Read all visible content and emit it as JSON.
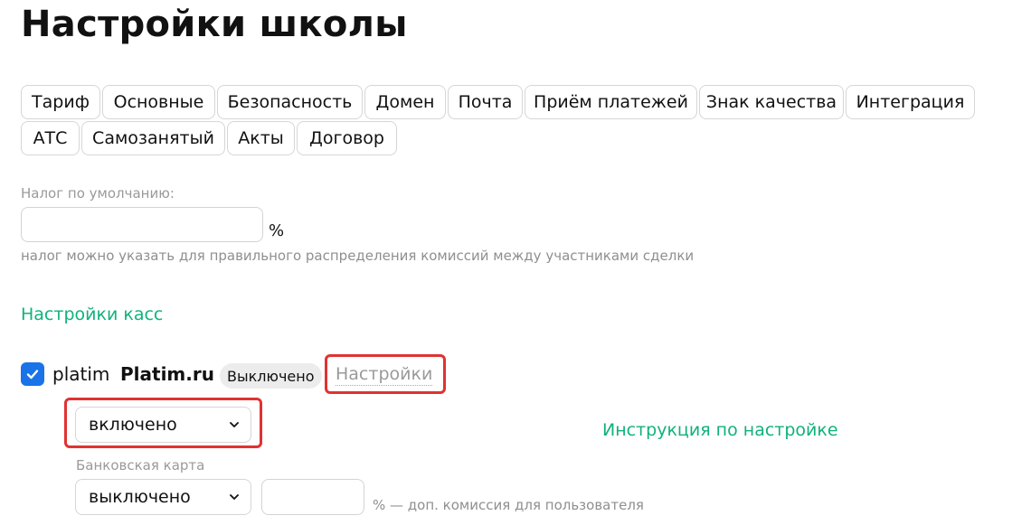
{
  "page": {
    "title": "Настройки школы"
  },
  "tabs": {
    "row1": [
      {
        "label": "Тариф"
      },
      {
        "label": "Основные"
      },
      {
        "label": "Безопасность"
      },
      {
        "label": "Домен"
      },
      {
        "label": "Почта"
      },
      {
        "label": "Приём платежей"
      },
      {
        "label": "Знак качества"
      },
      {
        "label": "Интеграция"
      }
    ],
    "row2": [
      {
        "label": "АТС"
      },
      {
        "label": "Самозанятый"
      },
      {
        "label": "Акты"
      },
      {
        "label": "Договор"
      }
    ]
  },
  "tax": {
    "label": "Налог по умолчанию:",
    "value": "",
    "unit": "%",
    "hint": "налог можно указать для правильного распределения комиссий между участниками сделки"
  },
  "cash_settings": {
    "title": "Настройки касс"
  },
  "provider": {
    "logo_text": "platim",
    "name": "Platim.ru",
    "checked": true,
    "status": "Выключено",
    "settings_link": "Настройки",
    "mode_select": "включено",
    "instruction_link": "Инструкция по настройке",
    "bank_card": {
      "label": "Банковская карта",
      "select": "выключено",
      "commission_value": "",
      "commission_hint": "% — доп. комиссия для пользователя"
    }
  },
  "colors": {
    "accent_green": "#10b27a",
    "checkbox_blue": "#1a73e8",
    "highlight_red": "#e03232"
  },
  "icons": {
    "checkbox": "check-icon",
    "select": "chevron-down-icon"
  }
}
